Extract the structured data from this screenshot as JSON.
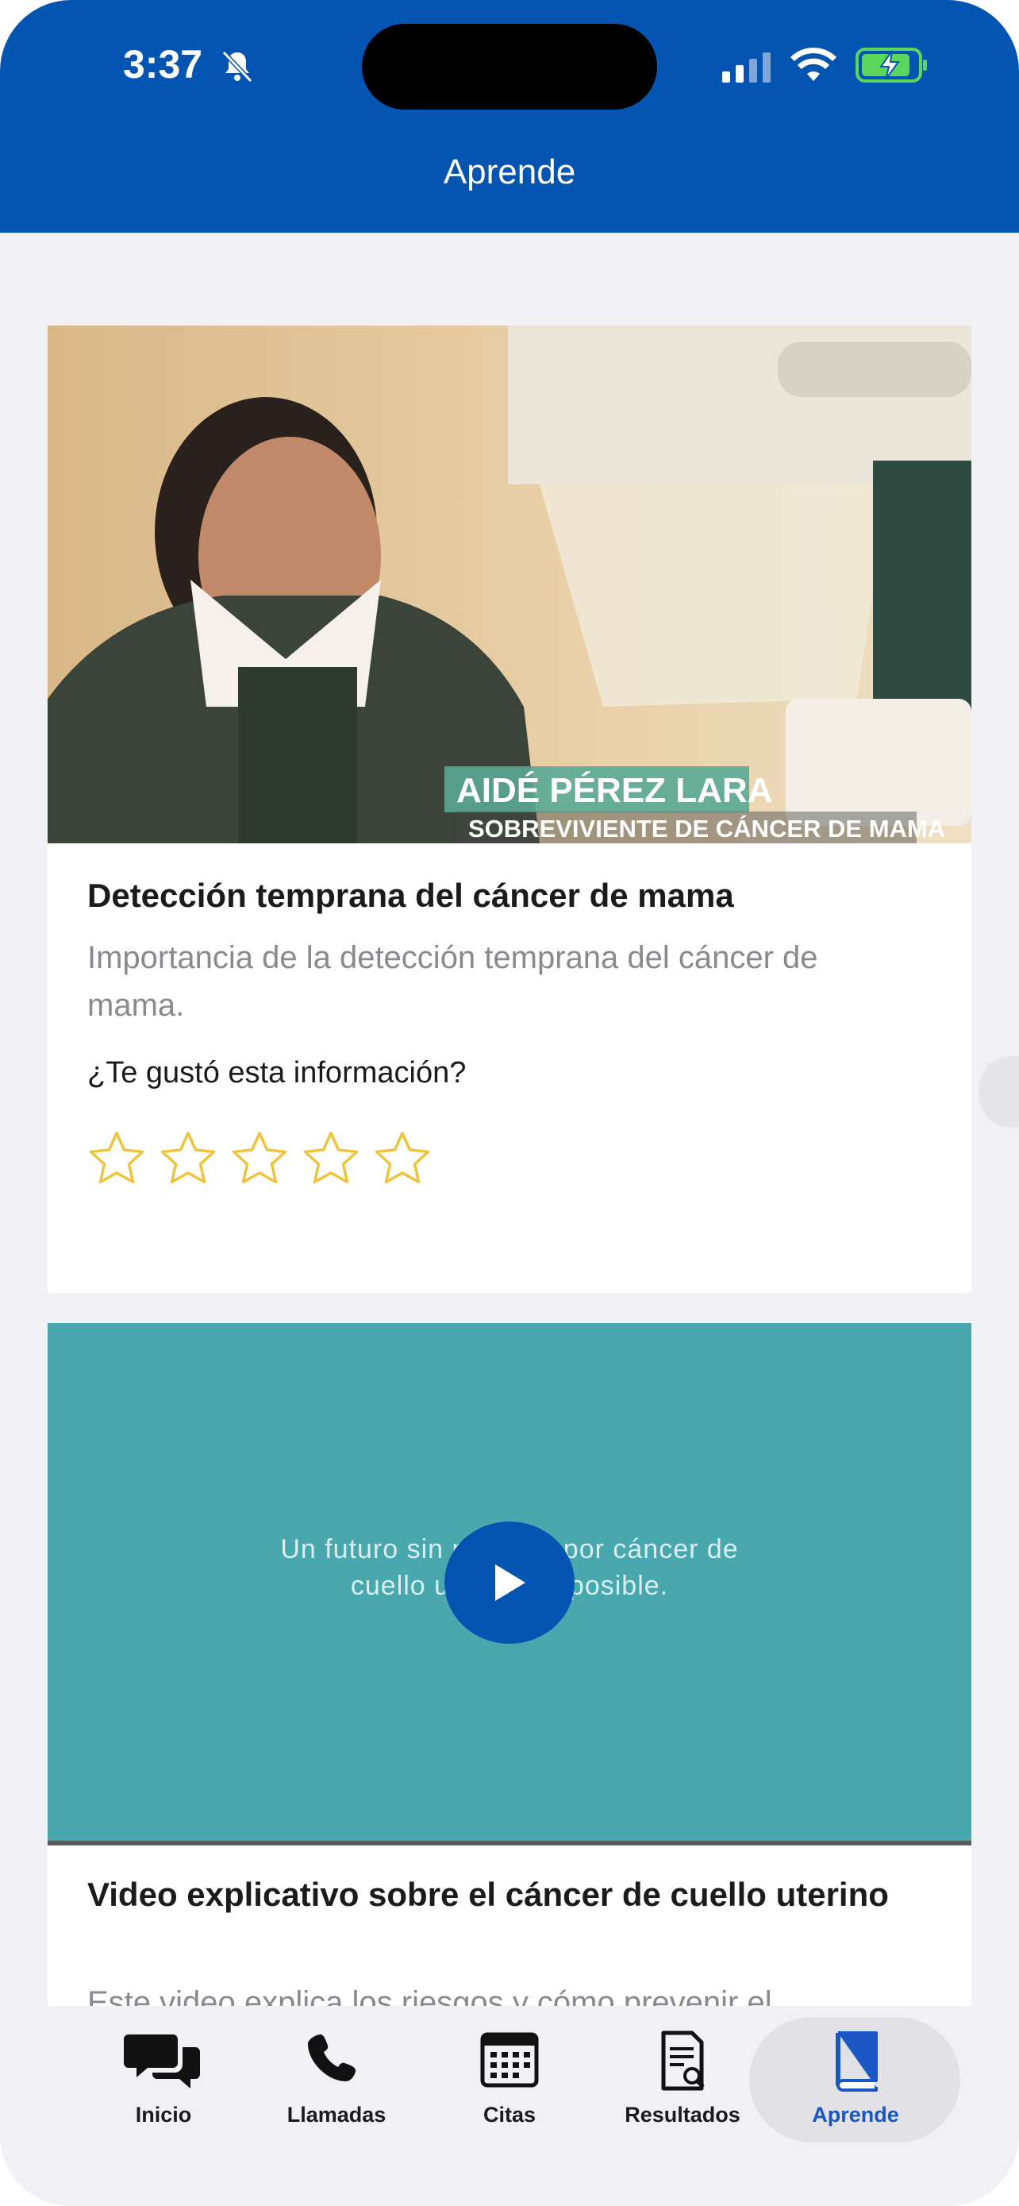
{
  "status_bar": {
    "time": "3:37"
  },
  "nav": {
    "title": "Aprende"
  },
  "cards": [
    {
      "video_caption_name": "AIDÉ PÉREZ LARA",
      "video_caption_role": "SOBREVIVIENTE DE CÁNCER DE MAMA",
      "title": "Detección temprana del cáncer de mama",
      "description": "Importancia de la detección temprana del cáncer de mama.",
      "rating_question": "¿Te gustó esta información?",
      "rating": {
        "value": 0,
        "max": 5
      }
    },
    {
      "video_text": "Un futuro sin muertes por cáncer de cuello uterino es posible.",
      "title": "Video explicativo sobre el cáncer de cuello uterino",
      "description": "Este video explica los riesgos y cómo prevenir el"
    }
  ],
  "tabbar": {
    "items": [
      {
        "label": "Inicio",
        "icon": "chat-bubbles-icon"
      },
      {
        "label": "Llamadas",
        "icon": "phone-icon"
      },
      {
        "label": "Citas",
        "icon": "calendar-icon"
      },
      {
        "label": "Resultados",
        "icon": "document-search-icon"
      },
      {
        "label": "Aprende",
        "icon": "book-icon",
        "active": true
      }
    ],
    "active_color": "#1a56c4"
  },
  "colors": {
    "brand_blue": "#0454b2",
    "video_teal": "#49a7ae",
    "star": "#f0c33c"
  }
}
